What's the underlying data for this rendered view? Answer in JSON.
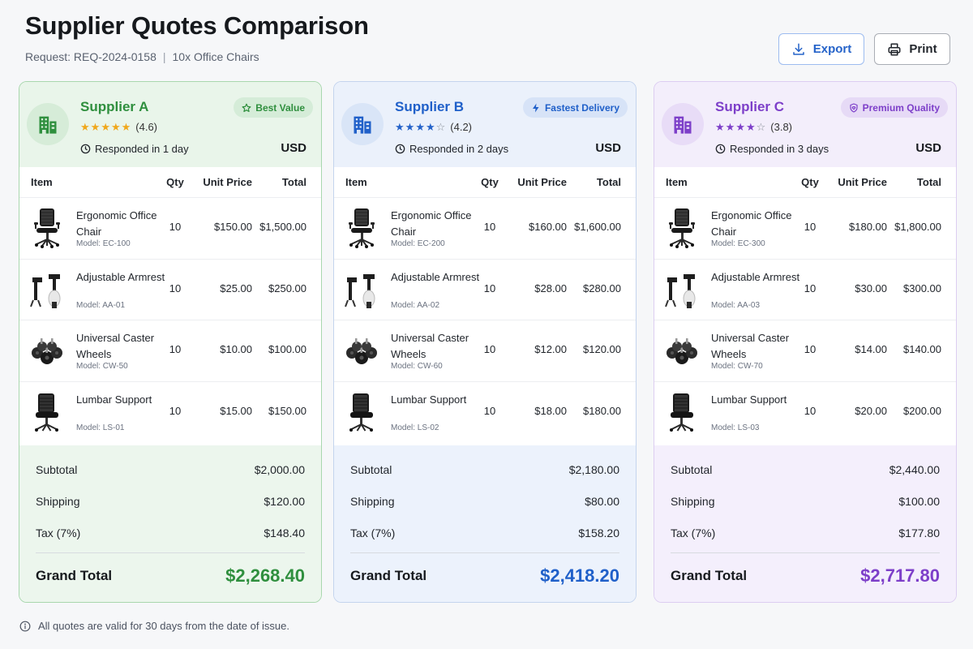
{
  "header": {
    "title": "Supplier Quotes Comparison",
    "request_label": "Request: REQ-2024-0158",
    "request_detail": "10x Office Chairs",
    "separator": "|",
    "export_label": "Export",
    "print_label": "Print"
  },
  "table_headers": {
    "item": "Item",
    "qty": "Qty",
    "unit_price": "Unit Price",
    "total": "Total"
  },
  "summary_labels": {
    "subtotal": "Subtotal",
    "shipping": "Shipping",
    "tax": "Tax (7%)",
    "grand_total": "Grand Total"
  },
  "suppliers": [
    {
      "name": "Supplier A",
      "badge": "Best Value",
      "badge_icon": "star-outline-icon",
      "rating_value": 4.6,
      "rating_text": "(4.6)",
      "responded": "Responded in 1 day",
      "currency": "USD",
      "accent": "#2f8f3e",
      "items": [
        {
          "name": "Ergonomic Office Chair",
          "model": "Model: EC-100",
          "qty": "10",
          "unit": "$150.00",
          "total": "$1,500.00",
          "icon": "office-chair-icon"
        },
        {
          "name": "Adjustable Armrest",
          "model": "Model: AA-01",
          "qty": "10",
          "unit": "$25.00",
          "total": "$250.00",
          "icon": "armrest-icon"
        },
        {
          "name": "Universal Caster Wheels",
          "model": "Model: CW-50",
          "qty": "10",
          "unit": "$10.00",
          "total": "$100.00",
          "icon": "caster-wheels-icon"
        },
        {
          "name": "Lumbar Support",
          "model": "Model: LS-01",
          "qty": "10",
          "unit": "$15.00",
          "total": "$150.00",
          "icon": "lumbar-chair-icon"
        }
      ],
      "subtotal": "$2,000.00",
      "shipping": "$120.00",
      "tax": "$148.40",
      "grand_total": "$2,268.40"
    },
    {
      "name": "Supplier B",
      "badge": "Fastest Delivery",
      "badge_icon": "lightning-icon",
      "rating_value": 4.2,
      "rating_text": "(4.2)",
      "responded": "Responded in 2 days",
      "currency": "USD",
      "accent": "#2060c9",
      "items": [
        {
          "name": "Ergonomic Office Chair",
          "model": "Model: EC-200",
          "qty": "10",
          "unit": "$160.00",
          "total": "$1,600.00",
          "icon": "office-chair-icon"
        },
        {
          "name": "Adjustable Armrest",
          "model": "Model: AA-02",
          "qty": "10",
          "unit": "$28.00",
          "total": "$280.00",
          "icon": "armrest-icon"
        },
        {
          "name": "Universal Caster Wheels",
          "model": "Model: CW-60",
          "qty": "10",
          "unit": "$12.00",
          "total": "$120.00",
          "icon": "caster-wheels-icon"
        },
        {
          "name": "Lumbar Support",
          "model": "Model: LS-02",
          "qty": "10",
          "unit": "$18.00",
          "total": "$180.00",
          "icon": "lumbar-chair-icon"
        }
      ],
      "subtotal": "$2,180.00",
      "shipping": "$80.00",
      "tax": "$158.20",
      "grand_total": "$2,418.20"
    },
    {
      "name": "Supplier C",
      "badge": "Premium Quality",
      "badge_icon": "shield-heart-icon",
      "rating_value": 3.8,
      "rating_text": "(3.8)",
      "responded": "Responded in 3 days",
      "currency": "USD",
      "accent": "#7d3fc9",
      "items": [
        {
          "name": "Ergonomic Office Chair",
          "model": "Model: EC-300",
          "qty": "10",
          "unit": "$180.00",
          "total": "$1,800.00",
          "icon": "office-chair-icon"
        },
        {
          "name": "Adjustable Armrest",
          "model": "Model: AA-03",
          "qty": "10",
          "unit": "$30.00",
          "total": "$300.00",
          "icon": "armrest-icon"
        },
        {
          "name": "Universal Caster Wheels",
          "model": "Model: CW-70",
          "qty": "10",
          "unit": "$14.00",
          "total": "$140.00",
          "icon": "caster-wheels-icon"
        },
        {
          "name": "Lumbar Support",
          "model": "Model: LS-03",
          "qty": "10",
          "unit": "$20.00",
          "total": "$200.00",
          "icon": "lumbar-chair-icon"
        }
      ],
      "subtotal": "$2,440.00",
      "shipping": "$100.00",
      "tax": "$177.80",
      "grand_total": "$2,717.80"
    }
  ],
  "footer": {
    "note": "All quotes are valid for 30 days from the date of issue.",
    "icon": "info-icon"
  }
}
